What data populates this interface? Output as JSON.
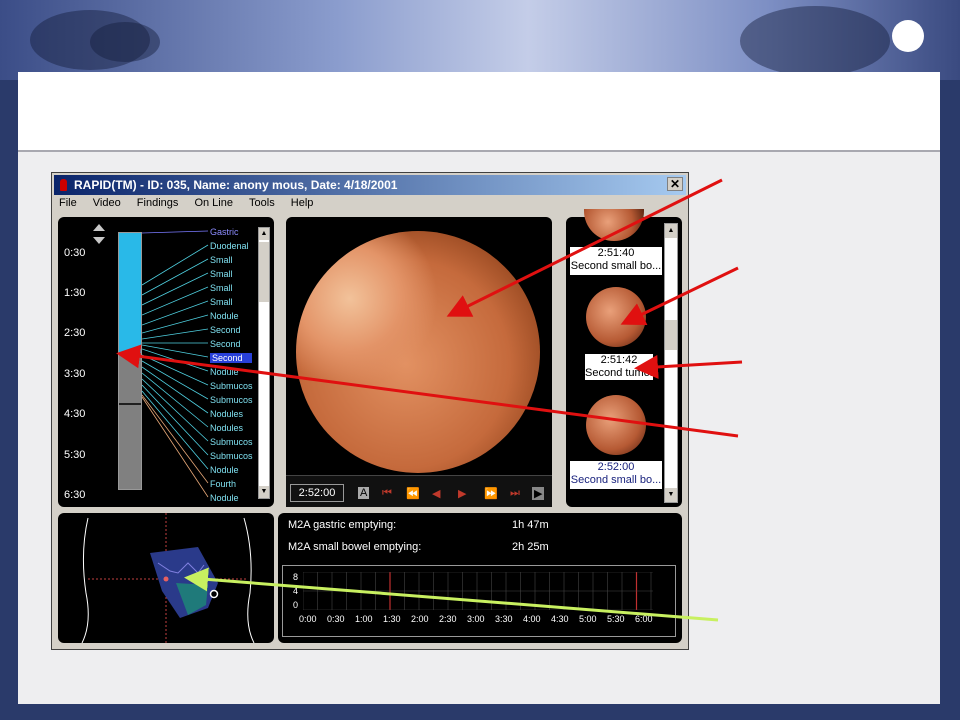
{
  "window": {
    "title": "RAPID(TM) - ID: 035, Name: anony mous, Date: 4/18/2001",
    "close": "✕"
  },
  "menu": [
    "File",
    "Video",
    "Findings",
    "On Line",
    "Tools",
    "Help"
  ],
  "timeline": {
    "time_labels": [
      "0:30",
      "1:30",
      "2:30",
      "3:30",
      "4:30",
      "5:30",
      "6:30"
    ],
    "findings": [
      "Gastric",
      "Duodenal",
      "Small",
      "Small",
      "Small",
      "Small",
      "Nodule",
      "Second",
      "Second",
      "Second",
      "Nodule",
      "Submucos",
      "Submucos",
      "Nodules",
      "Nodules",
      "Submucos",
      "Submucos",
      "Nodule",
      "Fourth",
      "Nodule"
    ],
    "selected_index": 9
  },
  "player": {
    "timestamp": "2:52:00",
    "controls": [
      "A",
      "⏮",
      "⏪",
      "◀",
      "▶",
      "⏩",
      "⏭",
      "▶"
    ]
  },
  "thumbnails": [
    {
      "time": "2:51:40",
      "label": "Second small bo..."
    },
    {
      "time": "2:51:42",
      "label": "Second tumor"
    },
    {
      "time": "2:52:00",
      "label": "Second small bo..."
    }
  ],
  "stats": [
    {
      "label": "M2A gastric emptying:",
      "value": "1h 47m"
    },
    {
      "label": "M2A small bowel emptying:",
      "value": "2h 25m"
    }
  ],
  "mini_chart": {
    "y_ticks": [
      "8",
      "4",
      "0"
    ],
    "x_ticks": [
      "0:00",
      "0:30",
      "1:00",
      "1:30",
      "2:00",
      "2:30",
      "3:00",
      "3:30",
      "4:00",
      "4:30",
      "5:00",
      "5:30",
      "6:00"
    ]
  },
  "colors": {
    "accent_red": "#e01010",
    "arrow_green": "#c8f060",
    "timeline_cyan": "#29b9e8",
    "selected": "#2840d8"
  }
}
